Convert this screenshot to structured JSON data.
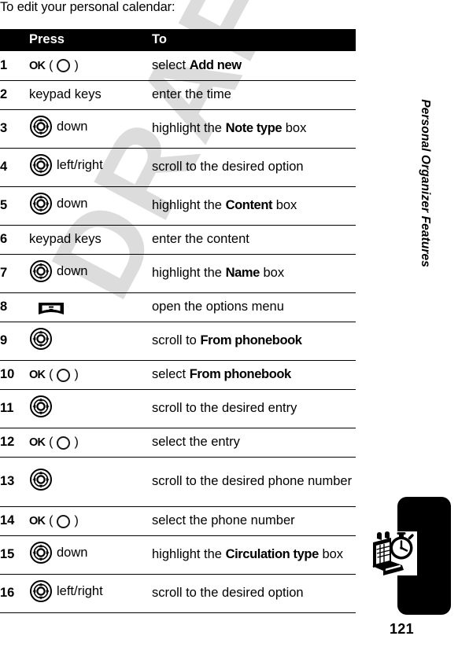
{
  "document": {
    "intro": "To edit your personal calendar:",
    "page_number": "121",
    "side_title": "Personal Organizer Features",
    "watermark": "DRAFT",
    "chapter_icon": "calendar-clock-icon"
  },
  "table": {
    "headers": {
      "number": "",
      "press": "Press",
      "to": "To"
    },
    "rows": [
      {
        "num": "1",
        "press_text": "OK",
        "press_icon": "ok-ring-icon",
        "press_suffix": "",
        "to_prefix": "select ",
        "to_bold": "Add new",
        "to_suffix": "",
        "height": "short"
      },
      {
        "num": "2",
        "press_text": "keypad keys",
        "press_icon": "",
        "press_suffix": "",
        "to_prefix": "enter the time",
        "to_bold": "",
        "to_suffix": "",
        "height": "short"
      },
      {
        "num": "3",
        "press_text": "",
        "press_icon": "nav-key-icon",
        "press_suffix": "down",
        "to_prefix": "highlight the ",
        "to_bold": "Note type",
        "to_suffix": " box",
        "height": "tall"
      },
      {
        "num": "4",
        "press_text": "",
        "press_icon": "nav-key-icon",
        "press_suffix": "left/right",
        "to_prefix": "scroll to the desired option",
        "to_bold": "",
        "to_suffix": "",
        "height": "tall"
      },
      {
        "num": "5",
        "press_text": "",
        "press_icon": "nav-key-icon",
        "press_suffix": "down",
        "to_prefix": "highlight the ",
        "to_bold": "Content",
        "to_suffix": " box",
        "height": "tall"
      },
      {
        "num": "6",
        "press_text": "keypad keys",
        "press_icon": "",
        "press_suffix": "",
        "to_prefix": "enter the content",
        "to_bold": "",
        "to_suffix": "",
        "height": "short"
      },
      {
        "num": "7",
        "press_text": "",
        "press_icon": "nav-key-icon",
        "press_suffix": "down",
        "to_prefix": "highlight the ",
        "to_bold": "Name",
        "to_suffix": " box",
        "height": "tall"
      },
      {
        "num": "8",
        "press_text": "",
        "press_icon": "menu-key-icon",
        "press_suffix": "",
        "to_prefix": "open the options menu",
        "to_bold": "",
        "to_suffix": "",
        "height": "short"
      },
      {
        "num": "9",
        "press_text": "",
        "press_icon": "nav-key-icon",
        "press_suffix": "",
        "to_prefix": "scroll to ",
        "to_bold": "From phonebook",
        "to_suffix": "",
        "height": "tall"
      },
      {
        "num": "10",
        "press_text": "OK",
        "press_icon": "ok-ring-icon",
        "press_suffix": "",
        "to_prefix": "select ",
        "to_bold": "From phonebook",
        "to_suffix": "",
        "height": "short"
      },
      {
        "num": "11",
        "press_text": "",
        "press_icon": "nav-key-icon",
        "press_suffix": "",
        "to_prefix": "scroll to the desired entry",
        "to_bold": "",
        "to_suffix": "",
        "height": "tall"
      },
      {
        "num": "12",
        "press_text": "OK",
        "press_icon": "ok-ring-icon",
        "press_suffix": "",
        "to_prefix": "select the entry",
        "to_bold": "",
        "to_suffix": "",
        "height": "short"
      },
      {
        "num": "13",
        "press_text": "",
        "press_icon": "nav-key-icon",
        "press_suffix": "",
        "to_prefix": "scroll to the desired phone number",
        "to_bold": "",
        "to_suffix": "",
        "height": "xtall"
      },
      {
        "num": "14",
        "press_text": "OK",
        "press_icon": "ok-ring-icon",
        "press_suffix": "",
        "to_prefix": "select the phone number",
        "to_bold": "",
        "to_suffix": "",
        "height": "short"
      },
      {
        "num": "15",
        "press_text": "",
        "press_icon": "nav-key-icon",
        "press_suffix": "down",
        "to_prefix": "highlight the ",
        "to_bold": "Circulation type",
        "to_suffix": " box",
        "height": "tall"
      },
      {
        "num": "16",
        "press_text": "",
        "press_icon": "nav-key-icon",
        "press_suffix": "left/right",
        "to_prefix": "scroll to the desired option",
        "to_bold": "",
        "to_suffix": "",
        "height": "tall"
      }
    ]
  },
  "colors": {
    "header_bg": "#000000",
    "header_fg": "#ffffff",
    "text": "#000000",
    "watermark": "#dcdcdc",
    "tab": "#000000"
  }
}
